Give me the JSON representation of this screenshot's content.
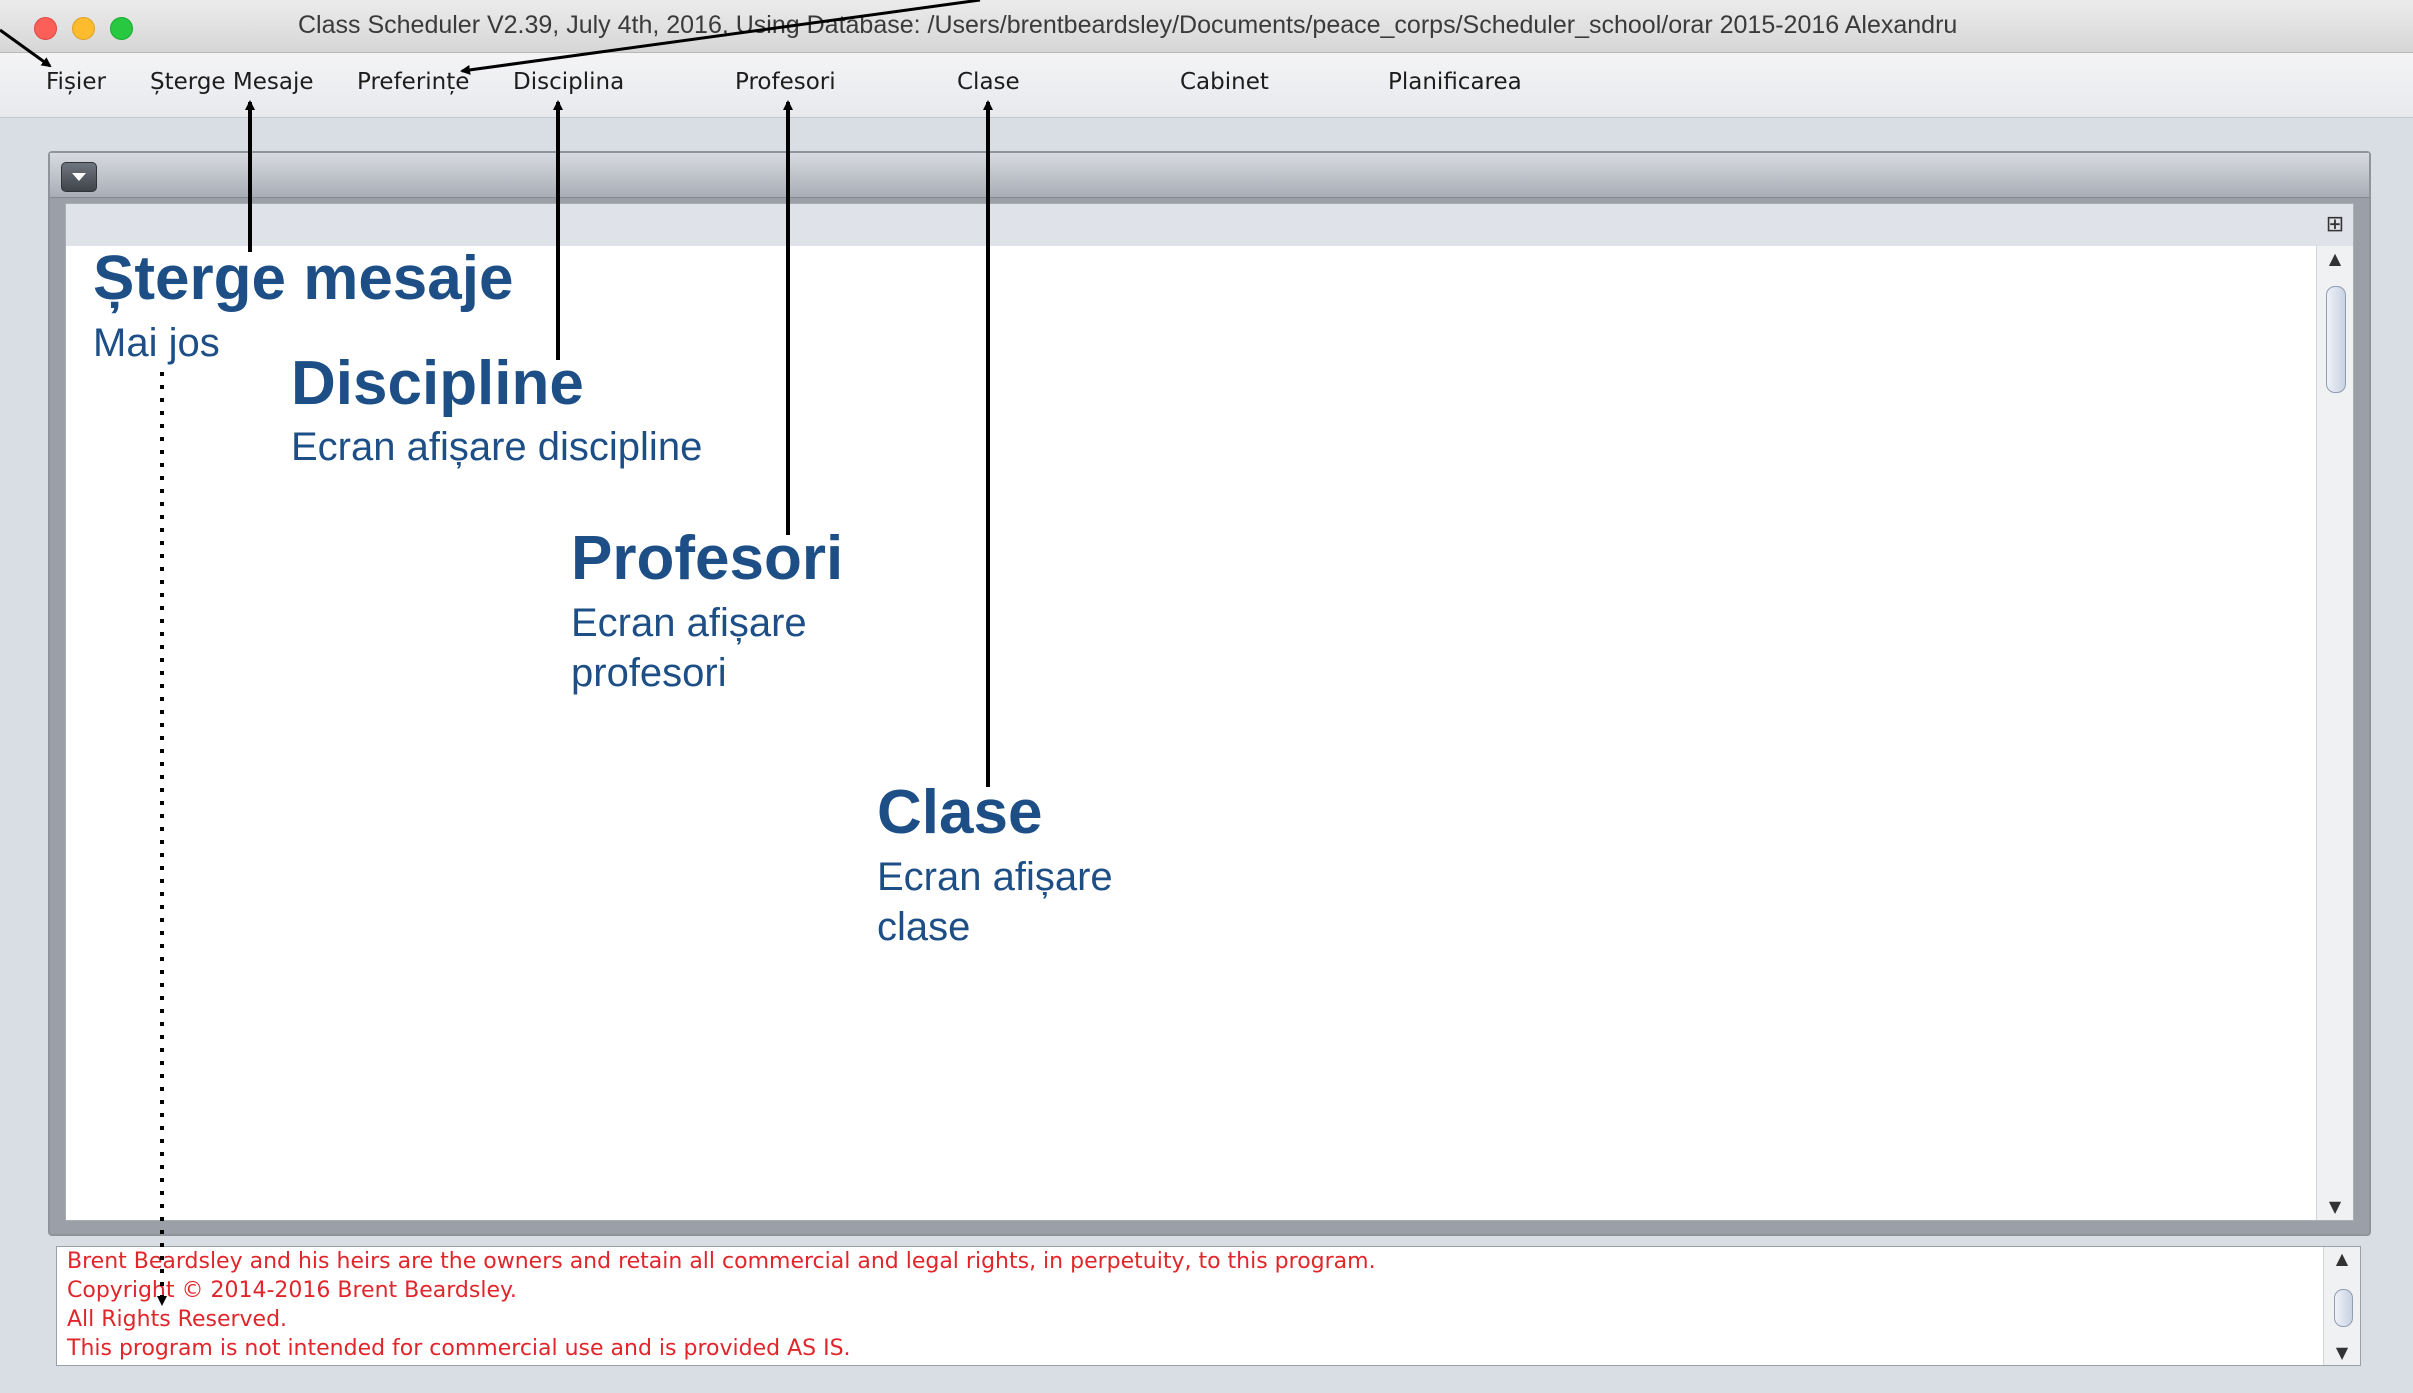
{
  "window": {
    "title": "Class Scheduler V2.39, July 4th, 2016, Using Database: /Users/brentbeardsley/Documents/peace_corps/Scheduler_school/orar 2015-2016 Alexandru"
  },
  "menu": [
    {
      "label": "Fișier"
    },
    {
      "label": "Șterge Mesaje"
    },
    {
      "label": "Preferințe"
    },
    {
      "label": "Disciplina"
    },
    {
      "label": "Profesori"
    },
    {
      "label": "Clase"
    },
    {
      "label": "Cabinet"
    },
    {
      "label": "Planificarea"
    }
  ],
  "annotations": {
    "sterge": {
      "title": "Șterge mesaje",
      "subtitle": "Mai jos"
    },
    "discipline": {
      "title": "Discipline",
      "subtitle": "Ecran afișare discipline"
    },
    "profesori": {
      "title": "Profesori",
      "subtitle_line1": "Ecran afișare",
      "subtitle_line2": "profesori"
    },
    "clase": {
      "title": "Clase",
      "subtitle_line1": "Ecran afișare",
      "subtitle_line2": "clase"
    }
  },
  "messages": [
    "Brent Beardsley and his heirs are the owners and retain all commercial and legal rights, in perpetuity, to this program.",
    "Copyright © 2014-2016 Brent Beardsley.",
    "All Rights Reserved.",
    "This program is not intended for commercial use and is provided AS IS."
  ],
  "colors": {
    "annotation": "#1d4f86",
    "message_text": "#e0262b"
  },
  "icons": [
    "close-window-icon",
    "minimize-window-icon",
    "zoom-window-icon",
    "collapse-arrow-icon",
    "pin-icon",
    "scroll-up-icon",
    "scroll-down-icon"
  ]
}
